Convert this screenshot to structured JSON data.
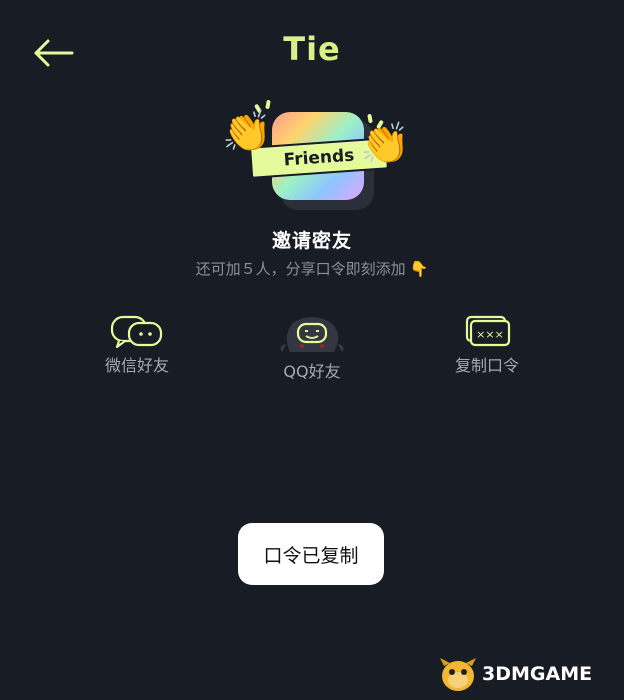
{
  "header": {
    "title": "Tie",
    "back_icon": "arrow-left-icon"
  },
  "hero": {
    "ribbon_text": "Friends",
    "left_icon": "clapping-hands-icon",
    "right_icon": "clapping-hands-icon"
  },
  "invite": {
    "heading": "邀请密友",
    "subtext": "还可加５人，分享口令即刻添加",
    "subtext_icon": "pointing-down-icon"
  },
  "share_options": [
    {
      "label": "微信好友",
      "icon": "wechat-icon"
    },
    {
      "label": "QQ好友",
      "icon": "qq-penguin-icon"
    },
    {
      "label": "复制口令",
      "icon": "copy-code-icon"
    }
  ],
  "toast": {
    "text": "口令已复制"
  },
  "watermark": {
    "text": "3DMGAME",
    "icon": "3dm-mascot-icon"
  },
  "colors": {
    "background": "#181c25",
    "accent": "#d8f08a",
    "icon_outline": "#e5fa9a",
    "label_gray": "#a4a9b2",
    "toast_bg": "#ffffff"
  }
}
